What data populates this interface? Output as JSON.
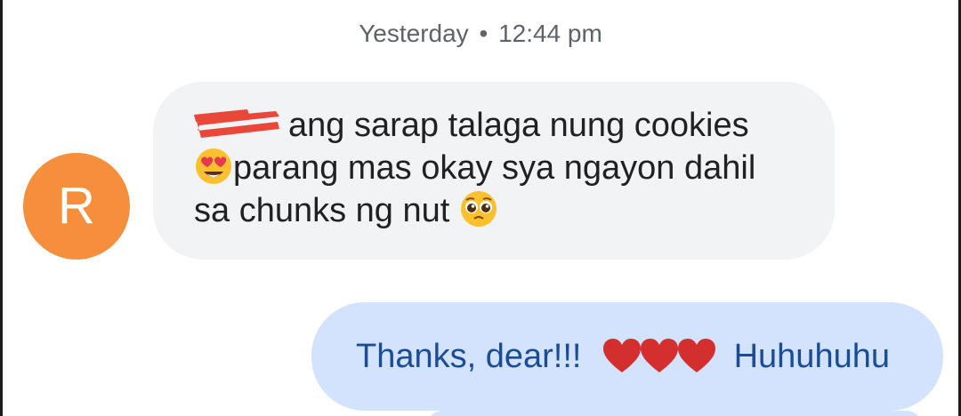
{
  "conversation": {
    "timestamp": {
      "day": "Yesterday",
      "separator": "•",
      "time": "12:44 pm"
    },
    "incoming": {
      "avatar_initial": "R",
      "redaction": "red-scribble-redaction",
      "line1_text": "ang sarap talaga nung cookies",
      "line1_emoji": "smiling-face-with-heart-eyes-emoji",
      "line2_text": "parang mas okay sya ngayon dahil",
      "line3_text": "sa chunks ng nut",
      "line3_emoji": "pleading-face-emoji"
    },
    "outgoing": {
      "text_before": "Thanks, dear!!!",
      "hearts": [
        "red-heart-emoji",
        "red-heart-emoji",
        "red-heart-emoji"
      ],
      "text_after": "Huhuhuhu"
    }
  },
  "colors": {
    "incoming_bubble": "#f1f3f4",
    "outgoing_bubble": "#d3e3fd",
    "outgoing_text": "#1a4d95",
    "avatar": "#f58f3b",
    "redaction": "#e8473a",
    "heart": "#d32f2f"
  }
}
